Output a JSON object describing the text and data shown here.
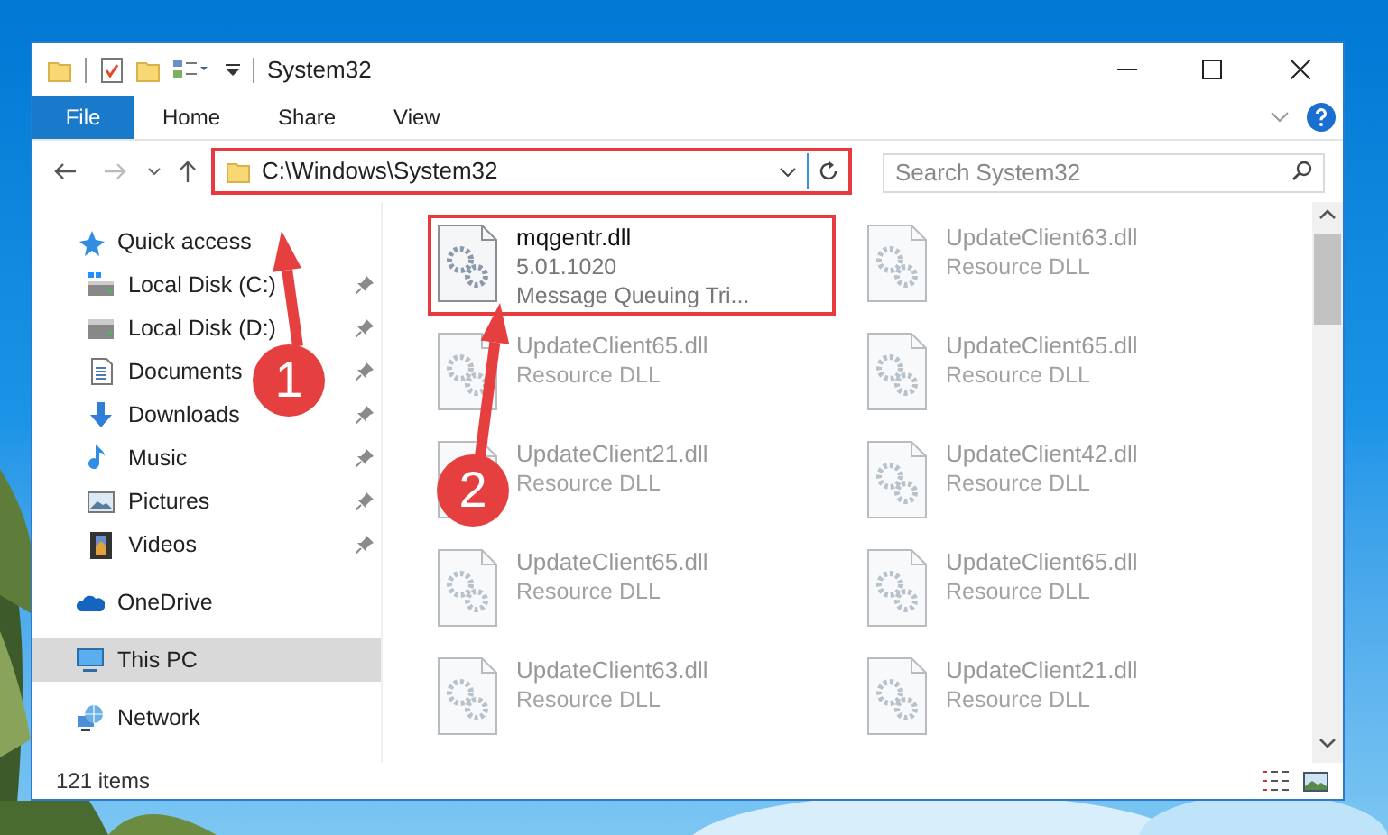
{
  "window": {
    "title": "System32"
  },
  "ribbon_tabs": [
    {
      "label": "File",
      "selected": true
    },
    {
      "label": "Home",
      "selected": false
    },
    {
      "label": "Share",
      "selected": false
    },
    {
      "label": "View",
      "selected": false
    }
  ],
  "address_bar": {
    "path": "C:\\Windows\\System32",
    "highlighted": true
  },
  "search": {
    "placeholder": "Search System32"
  },
  "navigation": [
    {
      "label": "Quick access",
      "kind": "quick",
      "selected": false,
      "children": [
        {
          "label": "Local Disk (C:)",
          "kind": "drive-c",
          "pinned": true
        },
        {
          "label": "Local Disk (D:)",
          "kind": "drive",
          "pinned": true
        },
        {
          "label": "Documents",
          "kind": "documents",
          "pinned": true
        },
        {
          "label": "Downloads",
          "kind": "downloads",
          "pinned": true
        },
        {
          "label": "Music",
          "kind": "music",
          "pinned": true
        },
        {
          "label": "Pictures",
          "kind": "pictures",
          "pinned": true
        },
        {
          "label": "Videos",
          "kind": "videos",
          "pinned": true
        }
      ]
    },
    {
      "label": "OneDrive",
      "kind": "cloud",
      "selected": false
    },
    {
      "label": "This PC",
      "kind": "pc",
      "selected": true
    },
    {
      "label": "Network",
      "kind": "network",
      "selected": false
    }
  ],
  "files": [
    {
      "name": "mqgentr.dll",
      "lines": [
        "5.01.1020",
        "Message Queuing Tri..."
      ],
      "highlighted": true,
      "blurred": false
    },
    {
      "name": "UpdateClient63.dll",
      "lines": [
        "Resource DLL"
      ],
      "highlighted": false,
      "blurred": true
    },
    {
      "name": "UpdateClient65.dll",
      "lines": [
        "Resource DLL"
      ],
      "highlighted": false,
      "blurred": true
    },
    {
      "name": "UpdateClient65.dll",
      "lines": [
        "Resource DLL"
      ],
      "highlighted": false,
      "blurred": true
    },
    {
      "name": "UpdateClient21.dll",
      "lines": [
        "Resource DLL"
      ],
      "highlighted": false,
      "blurred": true
    },
    {
      "name": "UpdateClient42.dll",
      "lines": [
        "Resource DLL"
      ],
      "highlighted": false,
      "blurred": true
    },
    {
      "name": "UpdateClient65.dll",
      "lines": [
        "Resource DLL"
      ],
      "highlighted": false,
      "blurred": true
    },
    {
      "name": "UpdateClient65.dll",
      "lines": [
        "Resource DLL"
      ],
      "highlighted": false,
      "blurred": true
    },
    {
      "name": "UpdateClient63.dll",
      "lines": [
        "Resource DLL"
      ],
      "highlighted": false,
      "blurred": true
    },
    {
      "name": "UpdateClient21.dll",
      "lines": [
        "Resource DLL"
      ],
      "highlighted": false,
      "blurred": true
    }
  ],
  "status_bar": {
    "item_count": "121 items"
  },
  "annotations": [
    {
      "number": "1"
    },
    {
      "number": "2"
    }
  ]
}
